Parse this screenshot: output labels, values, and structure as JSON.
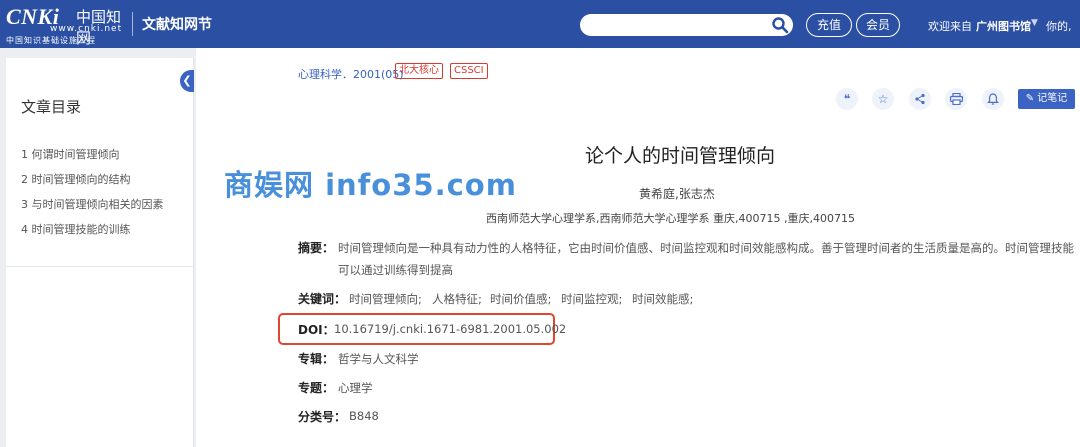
{
  "header": {
    "logo": {
      "main": "CNKi",
      "cn": "中国知网",
      "url": "www.cnki.net",
      "sub": "中国知识基础设施工程"
    },
    "site_title": "文献知网节",
    "search": {
      "placeholder": "",
      "icon": "search-icon"
    },
    "recharge_label": "充值",
    "member_label": "会员",
    "welcome": "欢迎来自",
    "org": "广州图书馆",
    "greet": "你的,"
  },
  "sidebar": {
    "title": "文章目录",
    "items": [
      {
        "label": "1 何谓时间管理倾向"
      },
      {
        "label": "2 时间管理倾向的结构"
      },
      {
        "label": "3 与时间管理倾向相关的因素"
      },
      {
        "label": "4 时间管理技能的训练"
      }
    ]
  },
  "article": {
    "source": "心理科学．2001(05)",
    "badges": [
      "北大核心",
      "CSSCI"
    ],
    "tools": [
      "quote-icon",
      "star-icon",
      "share-icon",
      "print-icon",
      "bell-icon"
    ],
    "note_label": "记笔记",
    "title": "论个人的时间管理倾向",
    "authors": "黄希庭,张志杰",
    "affiliation": "西南师范大学心理学系,西南师范大学心理学系 重庆,400715 ,重庆,400715",
    "fields": {
      "abstract_label": "摘要：",
      "abstract": "时间管理倾向是一种具有动力性的人格特征，它由时间价值感、时间监控观和时间效能感构成。善于管理时间者的生活质量是高的。时间管理技能可以通过训练得到提高",
      "keywords_label": "关键词：",
      "keywords": [
        "时间管理倾向;",
        "人格特征;",
        "时间价值感;",
        "时间监控观;",
        "时间效能感;"
      ],
      "doi_label": "DOI：",
      "doi": "10.16719/j.cnki.1671-6981.2001.05.002",
      "collection_label": "专辑：",
      "collection": "哲学与人文科学",
      "topic_label": "专题：",
      "topic": "心理学",
      "class_label": "分类号：",
      "class": "B848"
    }
  },
  "watermark": "商娱网 info35.com",
  "colors": {
    "header": "#2a4fa3",
    "accent": "#3b63c4",
    "badge": "#d63b30",
    "highlight": "#e0452e"
  }
}
